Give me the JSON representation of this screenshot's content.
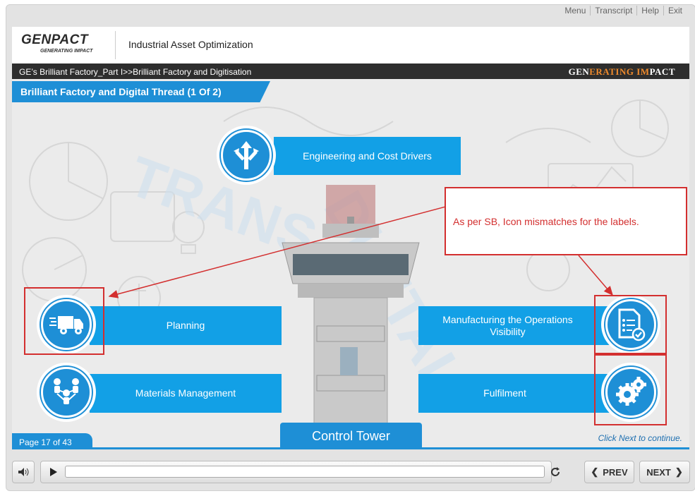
{
  "top_menu": [
    "Menu",
    "Transcript",
    "Help",
    "Exit"
  ],
  "header": {
    "logo_main": "GENPACT",
    "logo_sub": "GENERATING IMPACT",
    "course_title": "Industrial Asset Optimization"
  },
  "breadcrumb": "GE’s Brilliant Factory_Part I>>Brilliant Factory and Digitisation",
  "tagline": {
    "part1": "GEN",
    "part2": "ERATING ",
    "part3": "IM",
    "part4": "PACT"
  },
  "slide": {
    "title": "Brilliant Factory and Digital Thread (1 Of 2)",
    "items": {
      "engineering": "Engineering and Cost Drivers",
      "planning": "Planning",
      "materials": "Materials Management",
      "manufacturing": "Manufacturing the Operations Visibility",
      "fulfilment": "Fulfilment"
    },
    "center_label": "Control Tower",
    "review_note": "As per SB, Icon mismatches for the labels."
  },
  "footer": {
    "page": "Page 17 of 43",
    "continue_hint": "Click Next to continue."
  },
  "controls": {
    "prev": "PREV",
    "next": "NEXT"
  },
  "colors": {
    "accent": "#1e8fd6",
    "bar": "#12a0e6",
    "annotation": "#d32f2f",
    "brand_orange": "#ef8a2c"
  }
}
